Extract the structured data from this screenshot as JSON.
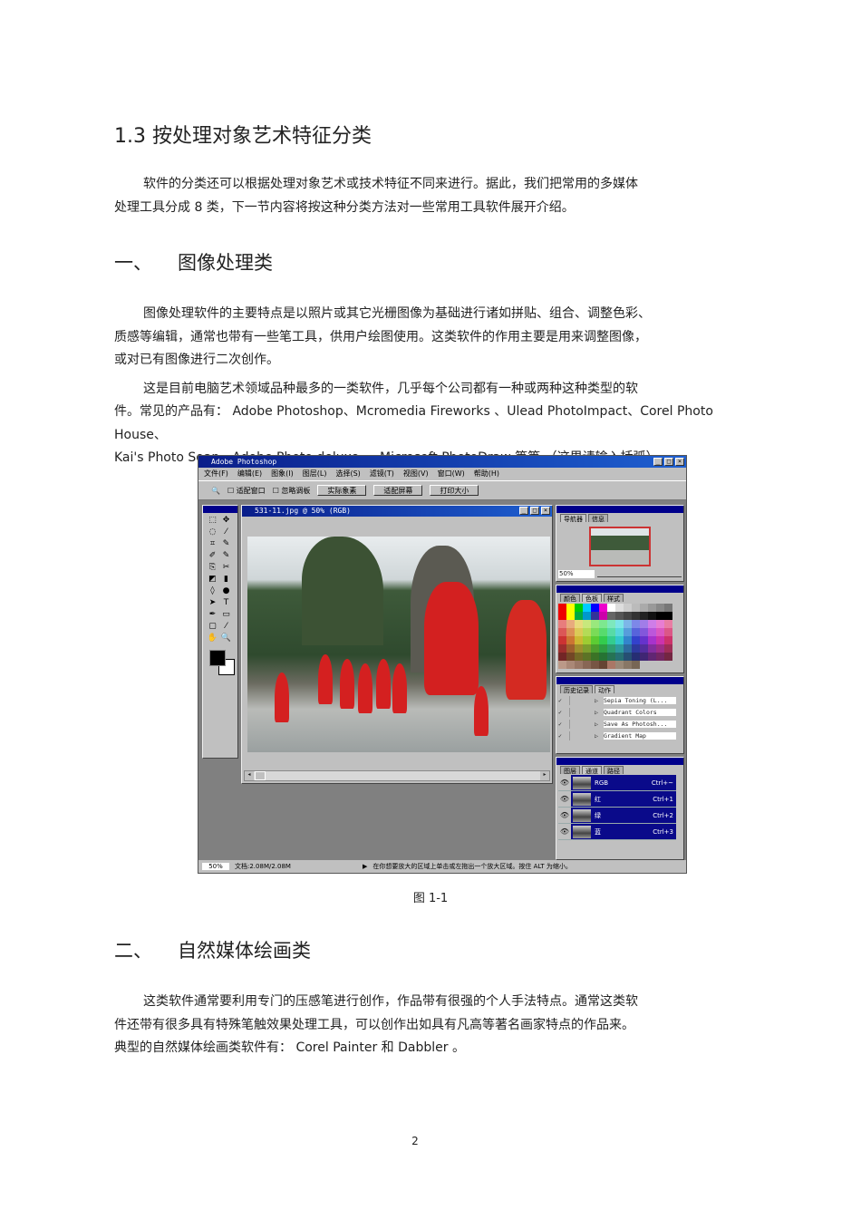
{
  "section_title": "1.3  按处理对象艺术特征分类",
  "intro": [
    "软件的分类还可以根据处理对象艺术或技术特征不同来进行。据此，我们把常用的多媒体",
    "处理工具分成    8 类，下一节内容将按这种分类方法对一些常用工具软件展开介绍。"
  ],
  "sec1": {
    "num": "一、",
    "title": "图像处理类",
    "para1": [
      "图像处理软件的主要特点是以照片或其它光栅图像为基础进行诸如拼贴、组合、调整色彩、",
      "质感等编辑，通常也带有一些笔工具，供用户绘图使用。这类软件的作用主要是用来调整图像，",
      "或对已有图像进行二次创作。"
    ],
    "para2": [
      "这是目前电脑艺术领域品种最多的一类软件，几乎每个公司都有一种或两种这种类型的软",
      "件。常见的产品有：  Adobe Photoshop、Mcromedia Fireworks 、Ulead PhotoImpact、Corel Photo House、",
      "Kai's Photo Soap、Adobe Photo deluxe 、 Microsoft PhotoDraw    等等  （这里请输入括弧）    。"
    ]
  },
  "figure_caption": "图    1-1",
  "sec2": {
    "num": "二、",
    "title": "自然媒体绘画类",
    "para": [
      "这类软件通常要利用专门的压感笔进行创作，作品带有很强的个人手法特点。通常这类软",
      "件还带有很多具有特殊笔触效果处理工具，可以创作出如具有凡高等著名画家特点的作品来。",
      "典型的自然媒体绘画类软件有：        Corel Painter       和  Dabbler  。"
    ]
  },
  "page_number": "2",
  "ps": {
    "title": "Adobe Photoshop",
    "menu": [
      "文件(F)",
      "编辑(E)",
      "图象(I)",
      "图层(L)",
      "选择(S)",
      "滤镜(T)",
      "视图(V)",
      "窗口(W)",
      "帮助(H)"
    ],
    "opt_fit_window": "适配窗口",
    "opt_ignore_palettes": "忽略调板",
    "btn_actual": "实际象素",
    "btn_fit": "适配屏幕",
    "btn_print": "打印大小",
    "doc_title": "531-11.jpg @ 50% (RGB)",
    "nav_tabs": [
      "导航器",
      "信息"
    ],
    "nav_zoom": "50%",
    "swatch_tabs": [
      "颜色",
      "色板",
      "样式"
    ],
    "history_tabs": [
      "历史记录",
      "动作"
    ],
    "actions": [
      "Sepia Toning (L...",
      "Quadrant Colors",
      "Save As Photosh...",
      "Gradient Map"
    ],
    "layer_tabs": [
      "图层",
      "通道",
      "路径"
    ],
    "channels": [
      {
        "name": "RGB",
        "key": "Ctrl+~"
      },
      {
        "name": "红",
        "key": "Ctrl+1"
      },
      {
        "name": "绿",
        "key": "Ctrl+2"
      },
      {
        "name": "蓝",
        "key": "Ctrl+3"
      }
    ],
    "status_zoom": "50%",
    "status_doc": "文档:2.08M/2.08M",
    "status_hint": "在你想要放大的区域上单击或左拖出一个放大区域。按住 ALT 为缩小。"
  }
}
